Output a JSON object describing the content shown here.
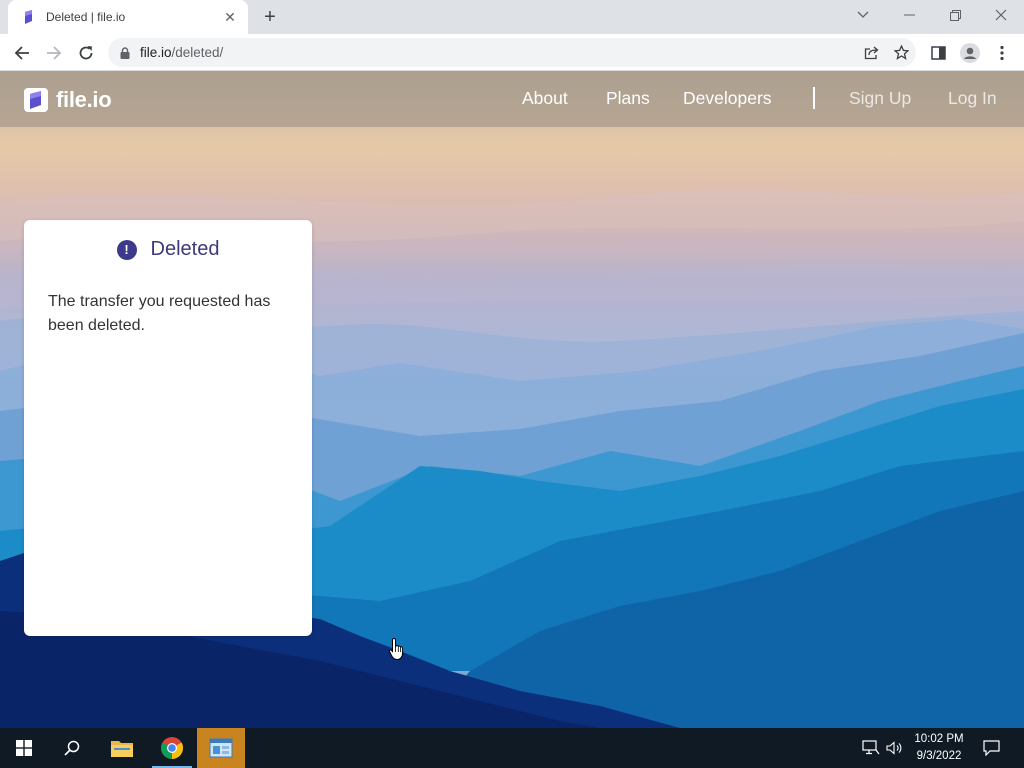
{
  "browser": {
    "tab_title": "Deleted | file.io",
    "new_tab_label": "+",
    "url_host": "file.io",
    "url_path": "/deleted/"
  },
  "site": {
    "logo_text": "file.io",
    "nav": {
      "about": "About",
      "plans": "Plans",
      "developers": "Developers",
      "sign_up": "Sign Up",
      "log_in": "Log In"
    }
  },
  "card": {
    "icon_glyph": "!",
    "title": "Deleted",
    "message": "The transfer you requested has been deleted."
  },
  "taskbar": {
    "time": "10:02 PM",
    "date": "9/3/2022"
  },
  "colors": {
    "accent": "#3d3a8a",
    "taskbar_bg": "#0f1a24",
    "active_app": "#c8841f"
  }
}
